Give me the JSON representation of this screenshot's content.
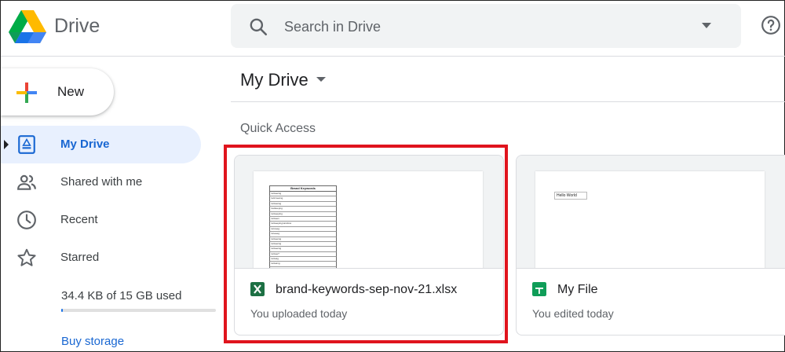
{
  "header": {
    "app_name": "Drive",
    "search_placeholder": "Search in Drive"
  },
  "sidebar": {
    "new_label": "New",
    "items": [
      {
        "label": "My Drive",
        "icon": "my-drive-icon",
        "active": true
      },
      {
        "label": "Shared with me",
        "icon": "shared-icon",
        "active": false
      },
      {
        "label": "Recent",
        "icon": "clock-icon",
        "active": false
      },
      {
        "label": "Starred",
        "icon": "star-icon",
        "active": false
      }
    ],
    "storage": {
      "text": "34.4 KB of 15 GB used",
      "used_fraction": 2e-06
    },
    "buy_storage_label": "Buy storage"
  },
  "main": {
    "title": "My Drive",
    "quick_access_label": "Quick Access",
    "files": [
      {
        "name": "brand-keywords-sep-nov-21.xlsx",
        "subtitle": "You uploaded today",
        "icon": "excel-icon",
        "thumbnail": {
          "title": "Brand Keywords",
          "rows": [
            "runkeeing",
            "rock keeing",
            "runkeeiog",
            "rouikeepng",
            "runkeeping",
            "runkeen",
            "runkeepingrunsfoss",
            "runneeg",
            "runeeeg",
            "runkeeing",
            "runkeeing",
            "runkeeing",
            "runkee?",
            "ronkeig",
            "runkeing",
            "runkeeing",
            "runkeign",
            "runkeer"
          ]
        }
      },
      {
        "name": "My File",
        "subtitle": "You edited today",
        "icon": "sheets-icon",
        "thumbnail": {
          "cell_text": "Hello World"
        }
      }
    ]
  },
  "colors": {
    "accent": "#1a73e8",
    "active_bg": "#e8f0fe",
    "highlight": "#e0141d",
    "excel_green": "#1d7044",
    "sheets_green": "#0f9d58"
  }
}
